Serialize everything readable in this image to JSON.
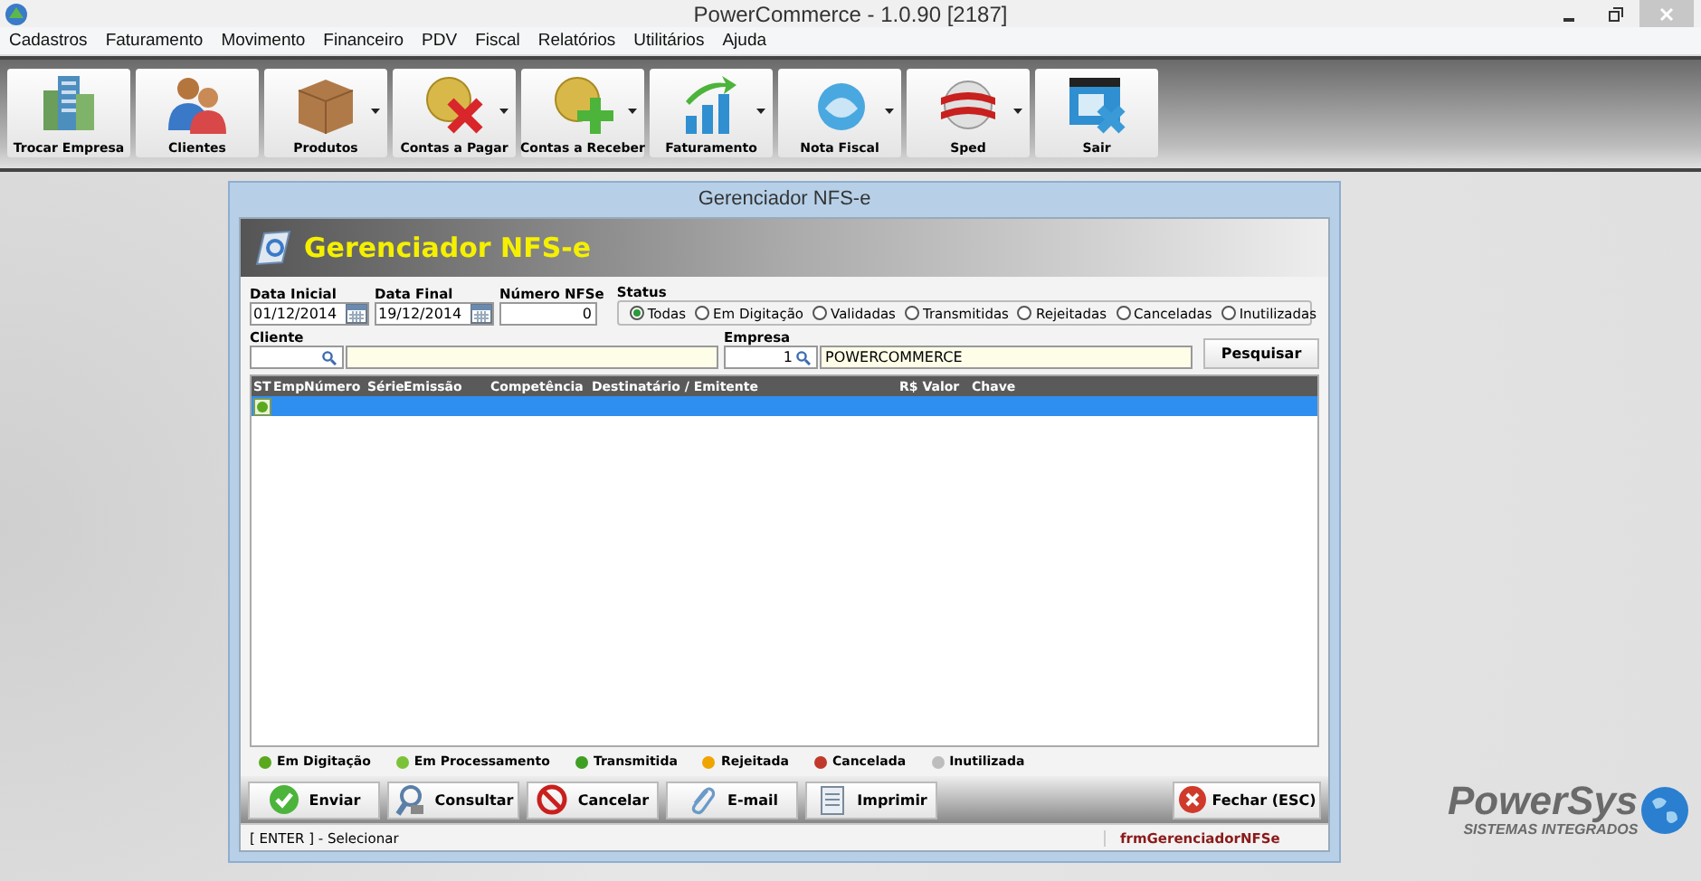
{
  "window": {
    "title": "PowerCommerce - 1.0.90 [2187]"
  },
  "menu": [
    "Cadastros",
    "Faturamento",
    "Movimento",
    "Financeiro",
    "PDV",
    "Fiscal",
    "Relatórios",
    "Utilitários",
    "Ajuda"
  ],
  "toolbar": [
    {
      "label": "Trocar Empresa",
      "kind": "building",
      "dropdown": false
    },
    {
      "label": "Clientes",
      "kind": "people",
      "dropdown": false
    },
    {
      "label": "Produtos",
      "kind": "box",
      "dropdown": true
    },
    {
      "label": "Contas a Pagar",
      "kind": "coin-x",
      "dropdown": true
    },
    {
      "label": "Contas a Receber",
      "kind": "coin-plus",
      "dropdown": true
    },
    {
      "label": "Faturamento",
      "kind": "chart",
      "dropdown": true
    },
    {
      "label": "Nota Fiscal",
      "kind": "nfe",
      "dropdown": true
    },
    {
      "label": "Sped",
      "kind": "sped",
      "dropdown": true
    },
    {
      "label": "Sair",
      "kind": "exit",
      "dropdown": false
    }
  ],
  "dialog": {
    "title": "Gerenciador NFS-e",
    "header": "Gerenciador NFS-e",
    "data_inicial": {
      "label": "Data Inicial",
      "value": "01/12/2014"
    },
    "data_final": {
      "label": "Data Final",
      "value": "19/12/2014"
    },
    "numero": {
      "label": "Número NFSe",
      "value": "0"
    },
    "status": {
      "label": "Status",
      "options": [
        {
          "label": "Todas",
          "selected": true
        },
        {
          "label": "Em Digitação",
          "selected": false
        },
        {
          "label": "Validadas",
          "selected": false
        },
        {
          "label": "Transmitidas",
          "selected": false
        },
        {
          "label": "Rejeitadas",
          "selected": false
        },
        {
          "label": "Canceladas",
          "selected": false
        },
        {
          "label": "Inutilizadas",
          "selected": false
        }
      ]
    },
    "cliente": {
      "label": "Cliente"
    },
    "empresa": {
      "label": "Empresa",
      "code": "1",
      "name": "POWERCOMMERCE"
    },
    "search_button": "Pesquisar",
    "grid": {
      "columns": [
        "ST",
        "Emp",
        "Número",
        "Série",
        "Emissão",
        "Competência",
        "Destinatário / Emitente",
        "R$ Valor",
        "Chave"
      ],
      "rows": [
        {
          "selected": true
        }
      ]
    },
    "legend": [
      {
        "label": "Em Digitação",
        "color": "#5aa81e"
      },
      {
        "label": "Em Processamento",
        "color": "#7cc238"
      },
      {
        "label": "Transmitida",
        "color": "#3f9e24"
      },
      {
        "label": "Rejeitada",
        "color": "#f0a400"
      },
      {
        "label": "Cancelada",
        "color": "#c0392b"
      },
      {
        "label": "Inutilizada",
        "color": "#bdbdbd"
      }
    ],
    "actions": [
      {
        "label": "Enviar",
        "kind": "check"
      },
      {
        "label": "Consultar",
        "kind": "query"
      },
      {
        "label": "Cancelar",
        "kind": "cancel"
      },
      {
        "label": "E-mail",
        "kind": "clip"
      },
      {
        "label": "Imprimir",
        "kind": "print"
      }
    ],
    "close_button": "Fechar (ESC)",
    "status_bar": {
      "hint": "[ ENTER ] - Selecionar",
      "form": "frmGerenciadorNFSe"
    }
  },
  "logo": {
    "name": "PowerSys",
    "tagline": "SISTEMAS INTEGRADOS"
  }
}
